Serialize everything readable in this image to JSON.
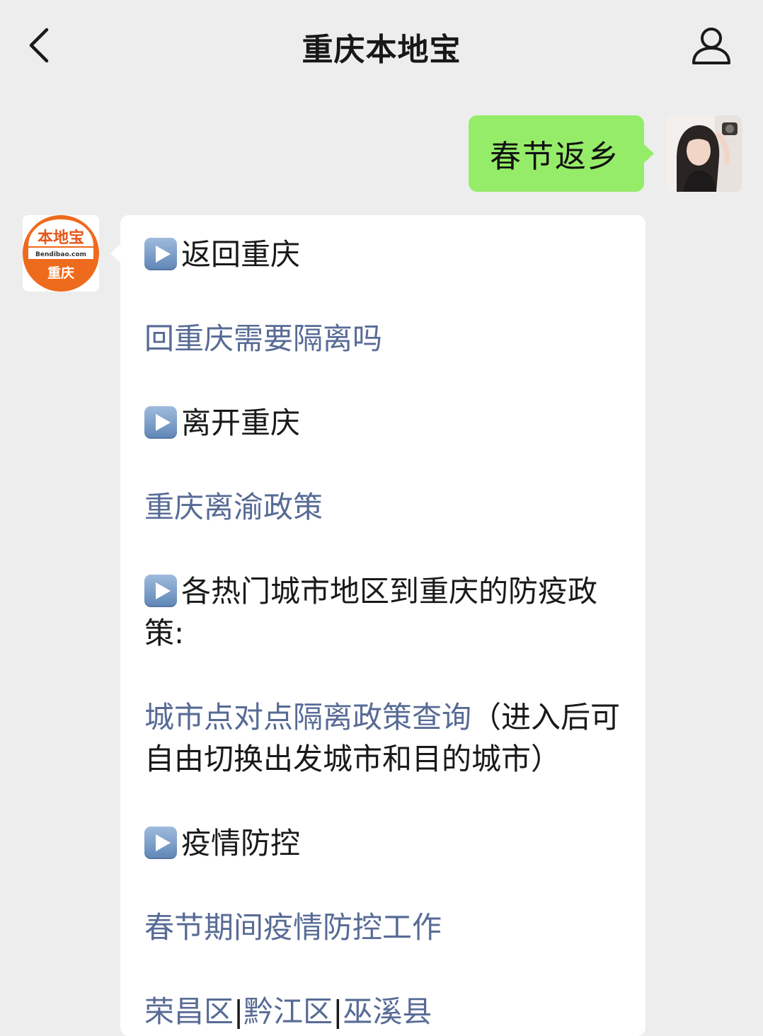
{
  "header": {
    "title": "重庆本地宝",
    "back_icon": "chevron-left-icon",
    "profile_icon": "person-icon"
  },
  "outgoing": {
    "text": "春节返乡",
    "bubble_color": "#95ec69"
  },
  "incoming": {
    "avatar": {
      "logo_text": "本地宝",
      "domain_text": "Bendibao.com",
      "city_text": "重庆",
      "brand_color": "#ee6a1c"
    },
    "sections": [
      {
        "heading": "返回重庆",
        "links": [
          "回重庆需要隔离吗"
        ]
      },
      {
        "heading": "离开重庆",
        "links": [
          "重庆离渝政策"
        ]
      },
      {
        "heading": "各热门城市地区到重庆的防疫政策:",
        "link": "城市点对点隔离政策查询",
        "link_suffix": "（进入后可自由切换出发城市和目的城市）"
      },
      {
        "heading": "疫情防控",
        "links": [
          "春节期间疫情防控工作"
        ],
        "district_links": [
          "荣昌区",
          "黔江区",
          "巫溪县"
        ],
        "separator": "|"
      }
    ],
    "link_color": "#576b95"
  }
}
